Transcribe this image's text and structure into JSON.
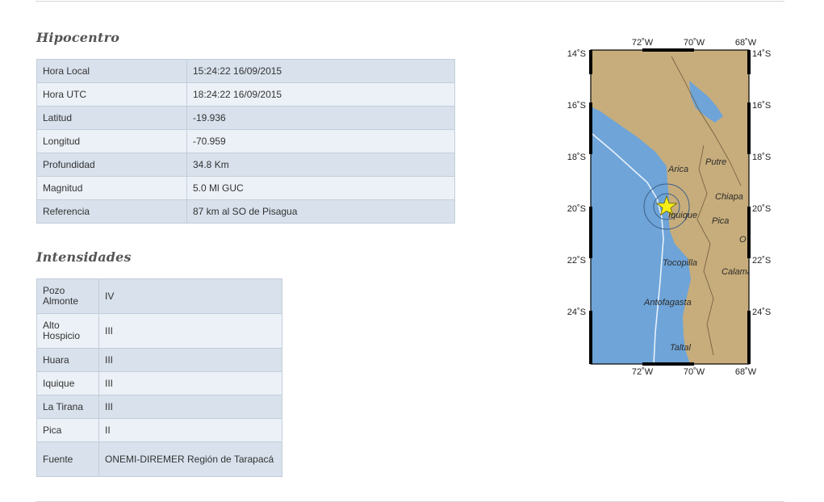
{
  "hipocentro": {
    "title": "Hipocentro",
    "rows": [
      {
        "label": "Hora Local",
        "value": "15:24:22 16/09/2015"
      },
      {
        "label": "Hora UTC",
        "value": "18:24:22 16/09/2015"
      },
      {
        "label": "Latitud",
        "value": "-19.936"
      },
      {
        "label": "Longitud",
        "value": "-70.959"
      },
      {
        "label": "Profundidad",
        "value": "34.8 Km"
      },
      {
        "label": "Magnitud",
        "value": "5.0 Ml GUC"
      },
      {
        "label": "Referencia",
        "value": "87 km al SO de Pisagua"
      }
    ]
  },
  "intensidades": {
    "title": "Intensidades",
    "rows": [
      {
        "label": "Pozo Almonte",
        "value": "IV"
      },
      {
        "label": "Alto Hospicio",
        "value": "III"
      },
      {
        "label": "Huara",
        "value": "III"
      },
      {
        "label": "Iquique",
        "value": "III"
      },
      {
        "label": "La Tirana",
        "value": "III"
      },
      {
        "label": "Pica",
        "value": "II"
      },
      {
        "label": "Fuente",
        "value": "ONEMI-DIREMER Región de Tarapacá"
      }
    ]
  },
  "map": {
    "lon_labels": [
      "72˚W",
      "70˚W",
      "68˚W"
    ],
    "lat_labels": [
      "14˚S",
      "16˚S",
      "18˚S",
      "20˚S",
      "22˚S",
      "24˚S"
    ],
    "places": [
      "Arica",
      "Putre",
      "Chiapa",
      "Iquique",
      "Pica",
      "Tocopilla",
      "Calama",
      "Antofagasta",
      "Taltal",
      "O"
    ],
    "epicenter_marker": "yellow-star",
    "colors": {
      "ocean": "#6ea4d8",
      "land": "#c7ad7b",
      "lake": "#6ea4d8",
      "trench": "#e7f1fb",
      "marker": "#f6ee18"
    }
  }
}
